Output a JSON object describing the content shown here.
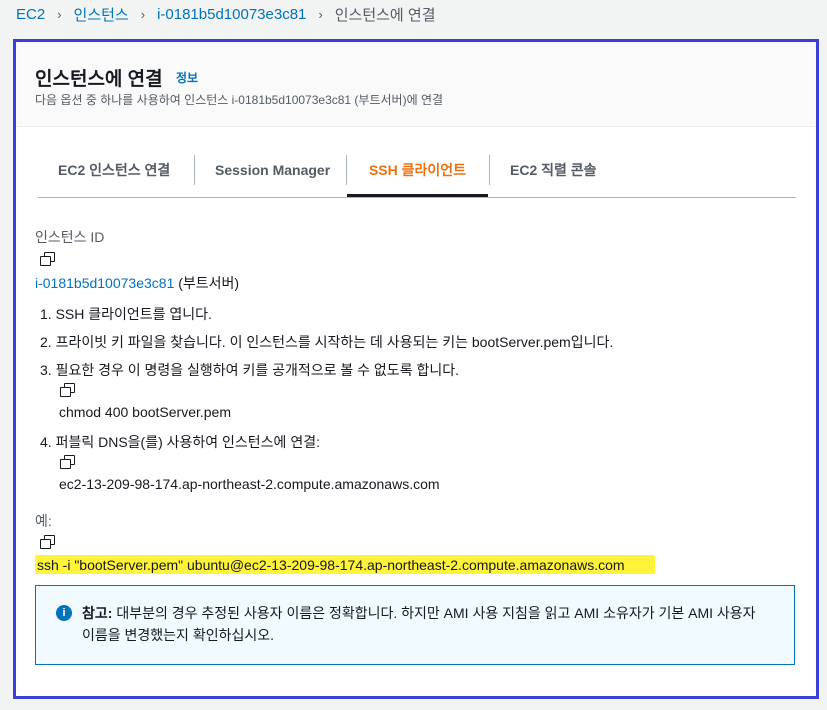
{
  "breadcrumb": {
    "items": [
      "EC2",
      "인스턴스",
      "i-0181b5d10073e3c81"
    ],
    "current": "인스턴스에 연결",
    "separator": "›"
  },
  "header": {
    "title": "인스턴스에 연결",
    "info_link": "정보",
    "description": "다음 옵션 중 하나를 사용하여 인스턴스 i-0181b5d10073e3c81 (부트서버)에 연결"
  },
  "tabs": [
    {
      "label": "EC2 인스턴스 연결",
      "active": false
    },
    {
      "label": "Session Manager",
      "active": false
    },
    {
      "label": "SSH 클라이언트",
      "active": true
    },
    {
      "label": "EC2 직렬 콘솔",
      "active": false
    }
  ],
  "instance": {
    "label": "인스턴스 ID",
    "id": "i-0181b5d10073e3c81",
    "name": "(부트서버)"
  },
  "steps": [
    "1. SSH 클라이언트를 엽니다.",
    "2. 프라이빗 키 파일을 찾습니다. 이 인스턴스를 시작하는 데 사용되는 키는 bootServer.pem입니다.",
    "3. 필요한 경우 이 명령을 실행하여 키를 공개적으로 볼 수 없도록 합니다.",
    "4. 퍼블릭 DNS을(를) 사용하여 인스턴스에 연결:"
  ],
  "commands": {
    "chmod": "chmod 400 bootServer.pem",
    "dns": "ec2-13-209-98-174.ap-northeast-2.compute.amazonaws.com"
  },
  "example": {
    "label": "예:",
    "command": "ssh -i \"bootServer.pem\" ubuntu@ec2-13-209-98-174.ap-northeast-2.compute.amazonaws.com"
  },
  "note": {
    "icon": "info-icon",
    "bold": "참고:",
    "text": " 대부분의 경우 추정된 사용자 이름은 정확합니다. 하지만 AMI 사용 지침을 읽고 AMI 소유자가 기본 AMI 사용자 이름을 변경했는지 확인하십시오."
  },
  "colors": {
    "link": "#0073bb",
    "active_tab": "#ec7211",
    "highlight": "#fff33b",
    "frame": "#3a3fd8"
  }
}
